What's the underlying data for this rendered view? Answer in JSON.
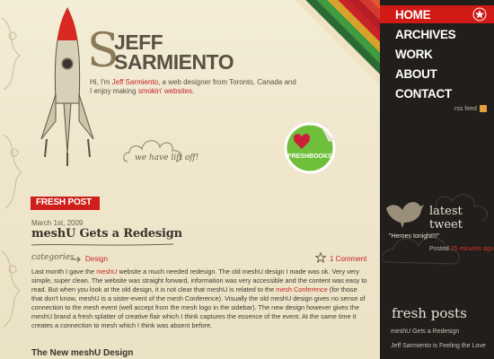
{
  "nav": {
    "items": [
      {
        "label": "HOME",
        "active": true
      },
      {
        "label": "ARCHIVES"
      },
      {
        "label": "WORK"
      },
      {
        "label": "ABOUT"
      },
      {
        "label": "CONTACT"
      }
    ],
    "rss_label": "rss feed"
  },
  "logo": {
    "first": "JEFF",
    "last": "SARMIENTO",
    "monogram": "S"
  },
  "intro": {
    "text1": "Hi, I'm ",
    "name": "Jeff Sarmiento",
    "text2": ", a web designer from Toronto, Canada and I enjoy making ",
    "highlight": "smokin' websites",
    "text3": "."
  },
  "liftoff_text": "we have lift off!",
  "badge": {
    "heart": "I",
    "label": "FRESHBOOKS"
  },
  "post": {
    "section_tag": "FRESH POST",
    "date": "March 1st, 2009",
    "title": "meshU Gets a Redesign",
    "categories_label": "categories",
    "category": "Design",
    "comments": "1 Comment",
    "body": {
      "p1": "Last month I gave the ",
      "link1": "meshU",
      "p2": " website a much needed redesign. The old meshU design I made was ok. Very very simple, super clean. The website was straight forward, information was very accessible and the content was easy to read. But when you look at the old design, it is not clear that meshU is related to the ",
      "link2": "mesh Conference",
      "p3": " (for those that don't know, meshU is a sister-event of the mesh Conference). Visually the old meshU design gives no sense of connection to the mesh event (well accept from the mesh logo in the sidebar). The new design however gives the meshU brand a fresh splatter of creative flair which I think captures the essence of the event. At the same time it creates a connection to mesh which I think was absent before."
    },
    "subheading": "The New meshU Design"
  },
  "sidebar": {
    "latest_tweet_title": "latest tweet",
    "tweet_text": "\"Heroes tonight!!!\"",
    "posted_prefix": "Posted ",
    "posted_time": "25 minutes ago",
    "fresh_posts_title": "fresh posts",
    "fresh_posts": [
      "meshU Gets a Redesign",
      "Jeff Sarmiento is Feeling the Love"
    ]
  },
  "colors": {
    "accent": "#d11a16",
    "sidebar": "#211e1b",
    "paper": "#efe6cc"
  }
}
